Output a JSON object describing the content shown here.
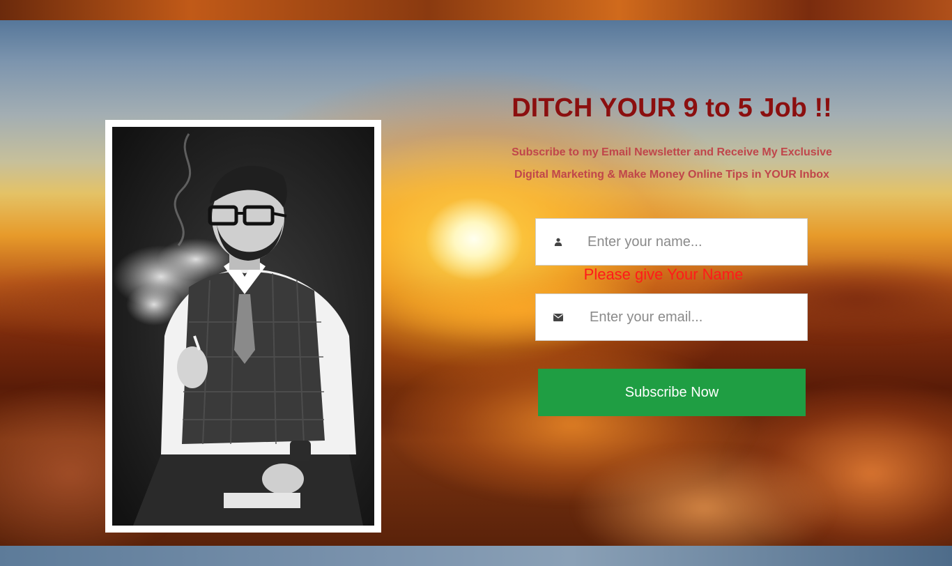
{
  "hero": {
    "headline": "DITCH YOUR 9 to 5 Job !!",
    "subheading_line1": "Subscribe to my Email Newsletter and Receive My Exclusive",
    "subheading_line2": "Digital Marketing & Make Money Online Tips in YOUR Inbox"
  },
  "form": {
    "name_field": {
      "placeholder": "Enter your name...",
      "value": "",
      "icon": "user-icon"
    },
    "name_error": "Please give Your Name",
    "email_field": {
      "placeholder": "Enter your email...",
      "value": "",
      "icon": "envelope-icon"
    },
    "submit_label": "Subscribe Now"
  },
  "photo": {
    "subject": "Man in glasses, vest and tie smoking a cigarette, black and white portrait"
  },
  "colors": {
    "headline": "#8b0f0f",
    "subheading": "#c0464a",
    "error": "#ff1a1a",
    "button": "#1f9e43",
    "button_text": "#ffffff"
  }
}
